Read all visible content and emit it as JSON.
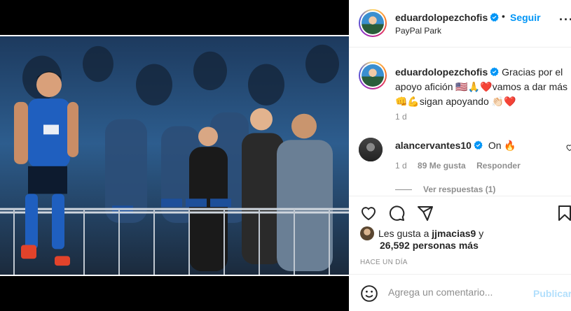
{
  "post": {
    "username": "eduardolopezchofis",
    "follow_label": "Seguir",
    "separator": "•",
    "location": "PayPal Park",
    "more_icon": "more-icon"
  },
  "caption": {
    "username": "eduardolopezchofis",
    "text": "Gracias por el apoyo afición 🇺🇸🙏❤️vamos a dar más 👊💪sigan apoyando 👏🏻❤️",
    "time": "1 d"
  },
  "comment": {
    "username": "alancervantes10",
    "text": "On 🔥",
    "time": "1 d",
    "likes": "89 Me gusta",
    "reply": "Responder",
    "view_replies": "Ver respuestas (1)"
  },
  "likes": {
    "prefix": "Les gusta a",
    "user": "jjmacias9",
    "suffix": "y",
    "others": "26,592 personas más"
  },
  "timestamp": "HACE UN DÍA",
  "add_comment": {
    "placeholder": "Agrega un comentario...",
    "publish": "Publicar"
  },
  "colors": {
    "accent": "#0095f6",
    "publish_disabled": "#b2dffc",
    "muted": "#8e8e8e"
  }
}
